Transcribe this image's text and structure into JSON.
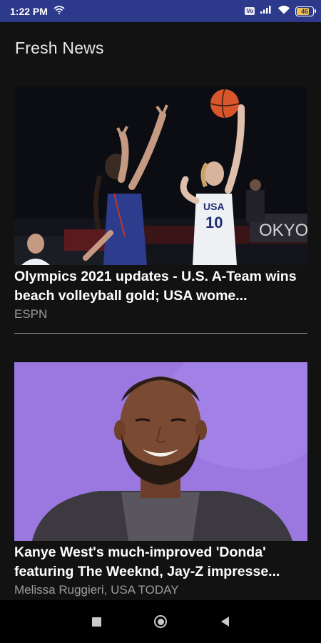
{
  "status_bar": {
    "time": "1:22 PM",
    "battery_text": "46",
    "battery_level": 0.46,
    "icons": [
      "wifi-icon",
      "vo-lte-badge",
      "signal-icon",
      "wifi-icon",
      "battery-icon"
    ],
    "badge_text": "Vo"
  },
  "page": {
    "title": "Fresh News"
  },
  "articles": [
    {
      "title": "Olympics 2021 updates - U.S. A-Team wins beach volleyball gold; USA wome...",
      "source": "ESPN",
      "image_alt": "basketball-players-photo",
      "jersey_number": "10",
      "jersey_text": "USA",
      "background_sign": "OKYO"
    },
    {
      "title": "Kanye West's much-improved 'Donda' featuring The Weeknd, Jay-Z impresse...",
      "source": "Melissa Ruggieri, USA TODAY",
      "image_alt": "kanye-west-portrait"
    }
  ],
  "nav_bar": {
    "buttons": [
      "recents-square-icon",
      "home-circle-icon",
      "back-triangle-icon"
    ]
  },
  "colors": {
    "status_bar": "#2d3a8c",
    "background": "#121212",
    "title_text": "#ffffff",
    "source_text": "#9c9c9c",
    "photo_2_bg": "#9a78e0"
  }
}
